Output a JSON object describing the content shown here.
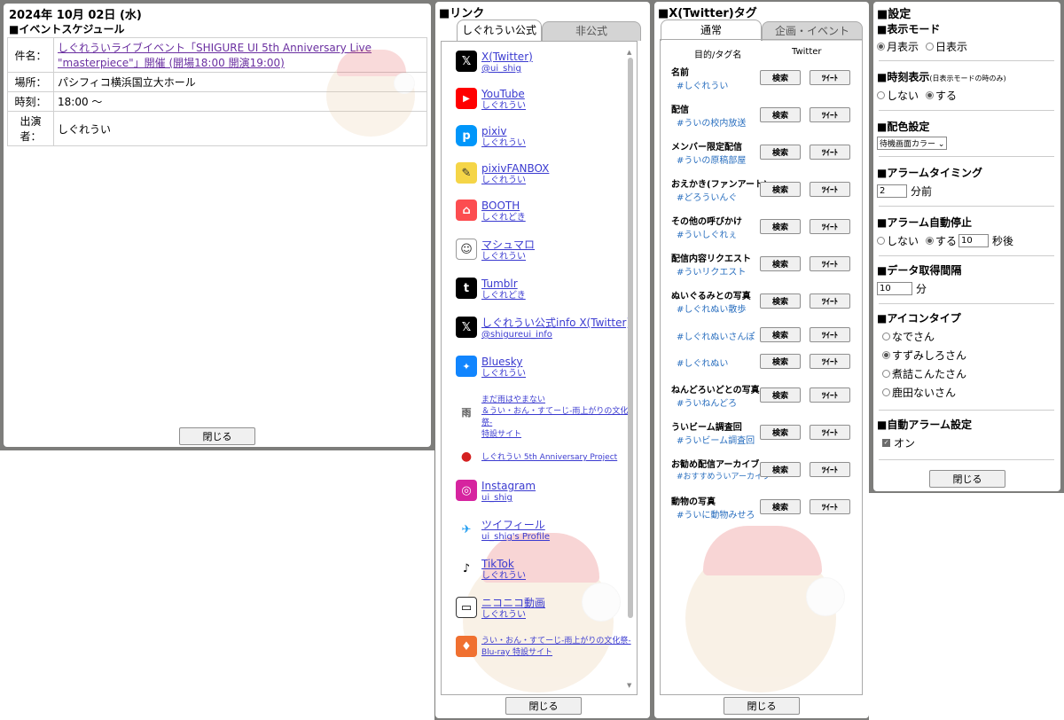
{
  "event": {
    "date": "2024年 10月 02日 (水)",
    "section": "■イベントスケジュール",
    "rows": [
      {
        "key": "件名：",
        "value": "しぐれういライブイベント「SHIGURE UI 5th Anniversary Live \"masterpiece\"」開催 (開場18:00 開演19:00)"
      },
      {
        "key": "場所：",
        "value": "パシフィコ横浜国立大ホール"
      },
      {
        "key": "時刻：",
        "value": "18:00 〜"
      },
      {
        "key": "出演者：",
        "value": "しぐれうい"
      }
    ],
    "close": "閉じる"
  },
  "links": {
    "title": "■リンク",
    "tabs": [
      "しぐれうい公式",
      "非公式"
    ],
    "items": [
      {
        "name": "X(Twitter)",
        "sub": "@ui_shig",
        "icon": "x-icon",
        "color": "#000000",
        "glyph": "𝕏"
      },
      {
        "name": "YouTube",
        "sub": "しぐれうい",
        "icon": "youtube-icon",
        "color": "#ff0000",
        "glyph": "▶"
      },
      {
        "name": "pixiv",
        "sub": "しぐれうい",
        "icon": "pixiv-icon",
        "color": "#0096fa",
        "glyph": "p"
      },
      {
        "name": "pixivFANBOX",
        "sub": "しぐれうい",
        "icon": "fanbox-icon",
        "color": "#f5d547",
        "glyph": "✎"
      },
      {
        "name": "BOOTH",
        "sub": "しぐれどき",
        "icon": "booth-icon",
        "color": "#fc4d50",
        "glyph": "⌂"
      },
      {
        "name": "マシュマロ",
        "sub": "しぐれうい",
        "icon": "marshmallow-icon",
        "color": "#ffffff",
        "glyph": "☺"
      },
      {
        "name": "Tumblr",
        "sub": "しぐれどき",
        "icon": "tumblr-icon",
        "color": "#000000",
        "glyph": "t"
      },
      {
        "name": "しぐれうい公式info X(Twitter)",
        "sub": "@shigureui_info",
        "icon": "x-info-icon",
        "color": "#000000",
        "glyph": "𝕏"
      },
      {
        "name": "Bluesky",
        "sub": "しぐれうい",
        "icon": "bluesky-icon",
        "color": "#1185fe",
        "glyph": "🦋"
      },
      {
        "name": "まだ雨はやまない\n＆うい・おん・すてーじ-雨上がりの文化祭-\n特設サイト",
        "sub": "",
        "icon": "rain-site-icon",
        "color": "#ffffff",
        "glyph": "雨"
      },
      {
        "name": "しぐれうい 5th Anniversary Project",
        "sub": "",
        "icon": "anniversary-icon",
        "color": "#ffffff",
        "glyph": "💧"
      },
      {
        "name": "Instagram",
        "sub": "ui_shig",
        "icon": "instagram-icon",
        "color": "#d6249f",
        "glyph": "◎"
      },
      {
        "name": "ツイフィール",
        "sub": "ui_shig's Profile",
        "icon": "twpf-icon",
        "color": "#ffffff",
        "glyph": "✈"
      },
      {
        "name": "TikTok",
        "sub": "しぐれうい",
        "icon": "tiktok-icon",
        "color": "#ffffff",
        "glyph": "♪"
      },
      {
        "name": "ニコニコ動画",
        "sub": "しぐれうい",
        "icon": "niconico-icon",
        "color": "#ffffff",
        "glyph": "▭"
      },
      {
        "name": "うい・おん・すてーじ-雨上がりの文化祭-\nBlu-ray 特設サイト",
        "sub": "",
        "icon": "bluray-icon",
        "color": "#f07030",
        "glyph": "♦"
      }
    ],
    "close": "閉じる"
  },
  "tags": {
    "title": "■X(Twitter)タグ",
    "tabs": [
      "通常",
      "企画・イベント"
    ],
    "head_purpose": "目的/タグ名",
    "head_twitter": "Twitter",
    "search": "検索",
    "tweet": "ﾂｲｰﾄ",
    "rows": [
      {
        "label": "名前",
        "tag": "#しぐれうい"
      },
      {
        "label": "配信",
        "tag": "#ういの校内放送"
      },
      {
        "label": "メンバー限定配信",
        "tag": "#ういの原稿部屋"
      },
      {
        "label": "おえかき(ファンアート)",
        "tag": "#どろういんぐ"
      },
      {
        "label": "その他の呼びかけ",
        "tag": "#ういしぐれぇ"
      },
      {
        "label": "配信内容リクエスト",
        "tag": "#ういリクエスト"
      },
      {
        "label": "ぬいぐるみとの写真",
        "tag": "#しぐれぬい散歩"
      },
      {
        "label": "",
        "tag": "#しぐれぬいさんぽ"
      },
      {
        "label": "",
        "tag": "#しぐれぬい"
      },
      {
        "label": "ねんどろいどとの写真",
        "tag": "#ういねんどろ"
      },
      {
        "label": "ういビーム調査回",
        "tag": "#ういビーム調査回"
      },
      {
        "label": "お勧め配信アーカイブ",
        "tag": "#おすすめういアーカイブ"
      },
      {
        "label": "動物の写真",
        "tag": "#ういに動物みせろ"
      }
    ],
    "close": "閉じる"
  },
  "settings": {
    "title": "■設定",
    "display_mode": {
      "title": "■表示モード",
      "opt1": "月表示",
      "opt2": "日表示"
    },
    "time_display": {
      "title": "■時刻表示",
      "note": "(日表示モードの時のみ)",
      "opt1": "しない",
      "opt2": "する"
    },
    "color": {
      "title": "■配色設定",
      "value": "待機画面カラー"
    },
    "alarm_timing": {
      "title": "■アラームタイミング",
      "value": "2",
      "unit": "分前"
    },
    "alarm_stop": {
      "title": "■アラーム自動停止",
      "opt1": "しない",
      "opt2": "する",
      "value": "10",
      "unit": "秒後"
    },
    "fetch": {
      "title": "■データ取得間隔",
      "value": "10",
      "unit": "分"
    },
    "icon_type": {
      "title": "■アイコンタイプ",
      "options": [
        "なでさん",
        "すずみしろさん",
        "煮詰こんたさん",
        "鹿田ないさん"
      ]
    },
    "auto_alarm": {
      "title": "■自動アラーム設定",
      "label": "オン"
    },
    "close": "閉じる"
  }
}
